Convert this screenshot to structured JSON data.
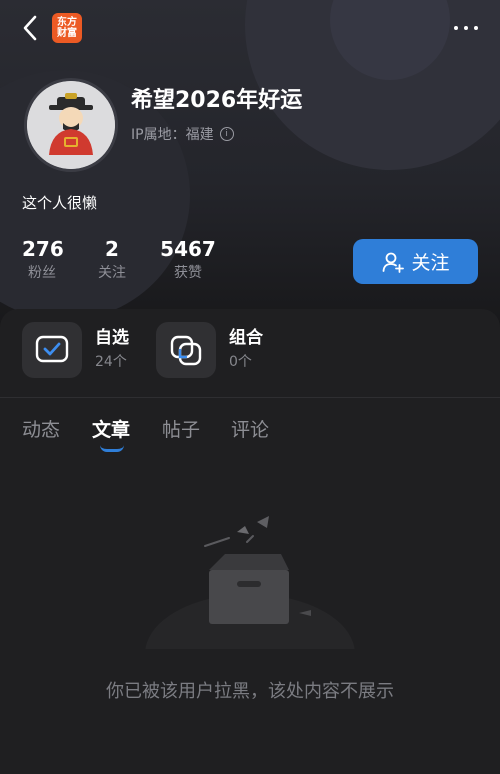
{
  "topbar": {
    "back_icon": "chevron-left-icon",
    "app_logo_line1": "东方",
    "app_logo_line2": "财富",
    "app_logo_color": "#ec5a24",
    "more_icon": "more-horizontal-icon"
  },
  "profile": {
    "username": "希望2026年好运",
    "ip_label": "IP属地：福建",
    "bio": "这个人很懒",
    "avatar": "caishen-avatar"
  },
  "stats": [
    {
      "value": "276",
      "label": "粉丝"
    },
    {
      "value": "2",
      "label": "关注"
    },
    {
      "value": "5467",
      "label": "获赞"
    }
  ],
  "follow_button": {
    "label": "关注",
    "icon": "user-add-icon",
    "color": "#2f7ed8"
  },
  "tiles": [
    {
      "title": "自选",
      "subtitle": "24个",
      "icon": "checkbox-icon"
    },
    {
      "title": "组合",
      "subtitle": "0个",
      "icon": "portfolio-icon"
    }
  ],
  "tabs": [
    {
      "label": "动态",
      "active": false
    },
    {
      "label": "文章",
      "active": true
    },
    {
      "label": "帖子",
      "active": false
    },
    {
      "label": "评论",
      "active": false
    }
  ],
  "empty_state": {
    "icon": "empty-box-icon",
    "message": "你已被该用户拉黑，该处内容不展示"
  }
}
